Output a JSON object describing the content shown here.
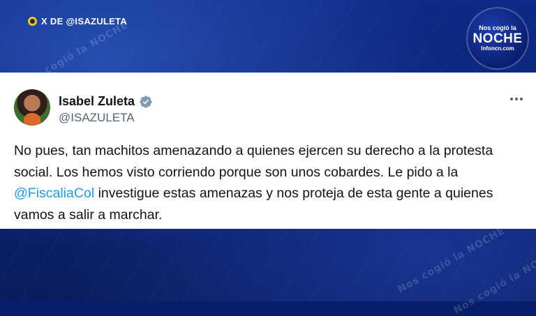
{
  "source": {
    "label": "X DE @ISAZULETA",
    "icon": "x-badge-icon"
  },
  "logo": {
    "top": "Nos cogió la",
    "middle": "NOCHE",
    "bottom": "Infoncn.com"
  },
  "post": {
    "author_name": "Isabel Zuleta",
    "handle": "@ISAZULETA",
    "verified": true,
    "verified_color": "#829aab",
    "text_part1": "No pues, tan machitos amenazando a quienes ejercen su derecho a la protesta social. Los hemos visto corriendo porque son unos cobardes. Le pido a la ",
    "mention": "@FiscaliaCol",
    "text_part2": " investigue estas amenazas y nos proteja de esta gente a quienes vamos a salir a marchar.",
    "mention_color": "#1d9bf0"
  },
  "watermark": {
    "text": "Nos cogió la NOCHE"
  }
}
